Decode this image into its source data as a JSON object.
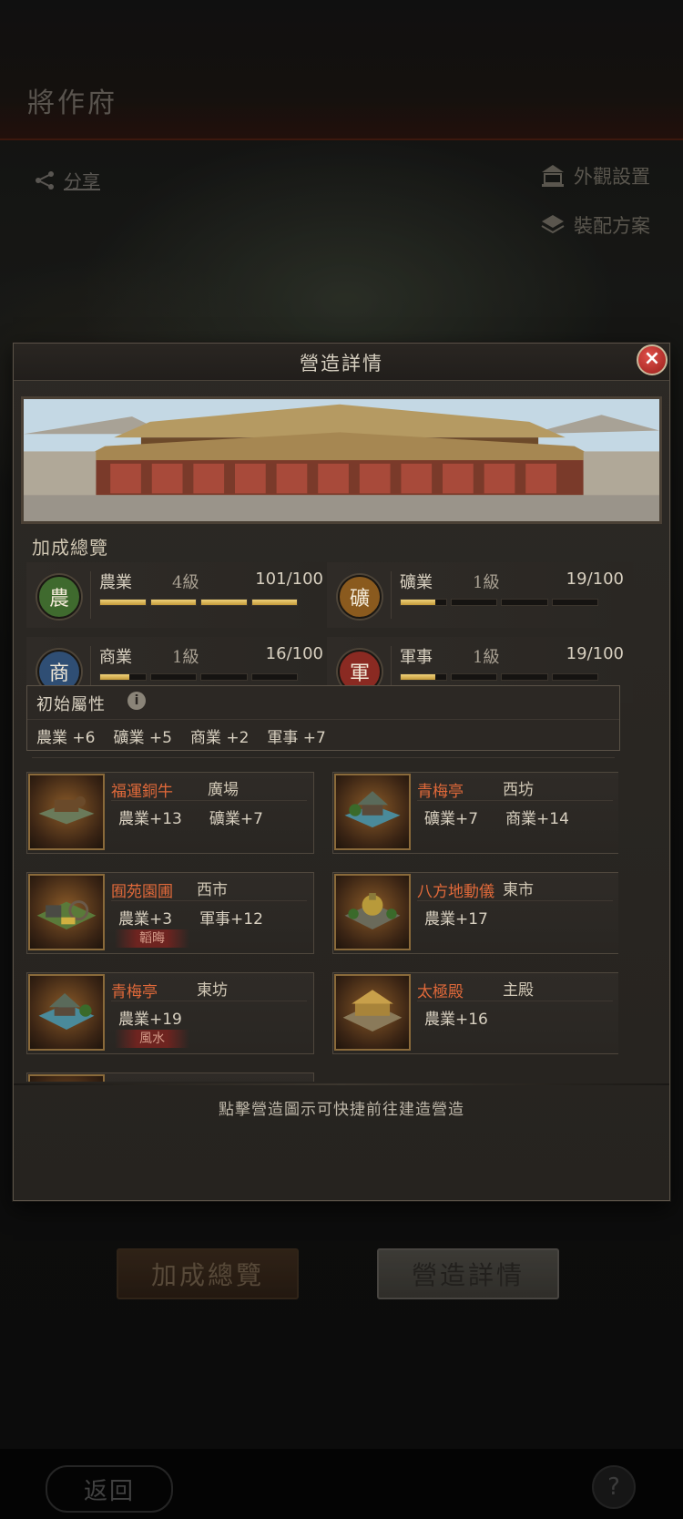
{
  "page": {
    "title": "將作府",
    "share_label": "分享",
    "appearance_label": "外觀設置",
    "equip_label": "裝配方案",
    "bottom_buttons": {
      "bonus_overview": "加成總覽",
      "build_details": "營造詳情"
    },
    "back_label": "返回",
    "help_label": "?"
  },
  "modal": {
    "title": "營造詳情",
    "close_icon": "close-icon",
    "bonus_title": "加成總覽",
    "stats": [
      {
        "emblem": "農",
        "name": "農業",
        "level": "4級",
        "progress": "101/100",
        "bars_filled": [
          1,
          1,
          1,
          1
        ],
        "color": "#3f6a2e"
      },
      {
        "emblem": "礦",
        "name": "礦業",
        "level": "1級",
        "progress": "19/100",
        "bars_filled": [
          0.76,
          0,
          0,
          0
        ],
        "color": "#8a5a1e"
      },
      {
        "emblem": "商",
        "name": "商業",
        "level": "1級",
        "progress": "16/100",
        "bars_filled": [
          0.64,
          0,
          0,
          0
        ],
        "color": "#2f4e74"
      },
      {
        "emblem": "軍",
        "name": "軍事",
        "level": "1級",
        "progress": "19/100",
        "bars_filled": [
          0.76,
          0,
          0,
          0
        ],
        "color": "#8a2a22"
      }
    ],
    "initial_attrs": {
      "title": "初始屬性",
      "values": [
        "農業 +6",
        "礦業 +5",
        "商業 +2",
        "軍事 +7"
      ]
    },
    "buildings": [
      {
        "name": "福運銅牛",
        "location": "廣場",
        "stats": [
          "農業+13",
          "礦業+7"
        ],
        "tag": ""
      },
      {
        "name": "青梅亭",
        "location": "西坊",
        "stats": [
          "礦業+7",
          "商業+14"
        ],
        "tag": ""
      },
      {
        "name": "囿苑園圃",
        "location": "西市",
        "stats": [
          "農業+3",
          "軍事+12"
        ],
        "tag": "韜晦"
      },
      {
        "name": "八方地動儀",
        "location": "東市",
        "stats": [
          "農業+17"
        ],
        "tag": ""
      },
      {
        "name": "青梅亭",
        "location": "東坊",
        "stats": [
          "農業+19"
        ],
        "tag": "風水"
      },
      {
        "name": "太極殿",
        "location": "主殿",
        "stats": [
          "農業+16"
        ],
        "tag": ""
      }
    ],
    "hint": "點擊營造圖示可快捷前往建造營造"
  }
}
